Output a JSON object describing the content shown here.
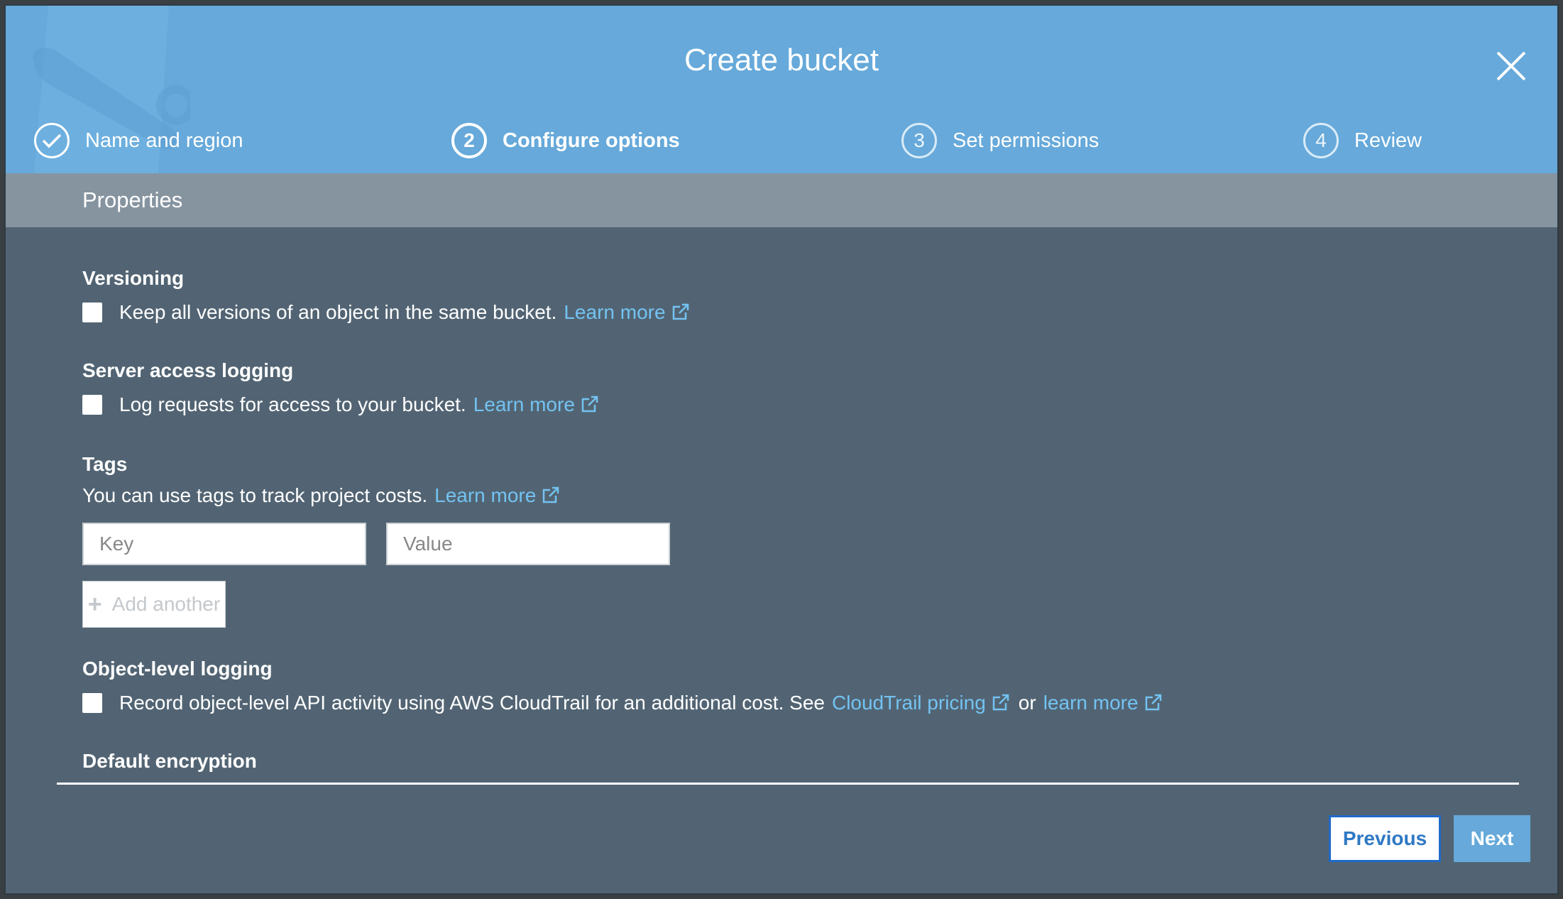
{
  "modal": {
    "title": "Create bucket",
    "steps": [
      {
        "number": "",
        "label": "Name and region",
        "state": "completed"
      },
      {
        "number": "2",
        "label": "Configure options",
        "state": "active"
      },
      {
        "number": "3",
        "label": "Set permissions",
        "state": "pending"
      },
      {
        "number": "4",
        "label": "Review",
        "state": "pending"
      }
    ],
    "section_header": "Properties"
  },
  "versioning": {
    "title": "Versioning",
    "text": "Keep all versions of an object in the same bucket.",
    "link": "Learn more",
    "checked": false
  },
  "server_logging": {
    "title": "Server access logging",
    "text": "Log requests for access to your bucket.",
    "link": "Learn more",
    "checked": false
  },
  "tags": {
    "title": "Tags",
    "text": "You can use tags to track project costs.",
    "link": "Learn more",
    "key_placeholder": "Key",
    "value_placeholder": "Value",
    "add_label": "Add another"
  },
  "object_logging": {
    "title": "Object-level logging",
    "text": "Record object-level API activity using AWS CloudTrail for an additional cost. See",
    "link1": "CloudTrail pricing",
    "or_text": "or",
    "link2": "learn more",
    "checked": false
  },
  "default_encryption": {
    "title": "Default encryption"
  },
  "footer": {
    "previous_label": "Previous",
    "next_label": "Next"
  },
  "colors": {
    "header_bg": "#66a9da",
    "body_bg": "#526473",
    "properties_bar": "#8694a0",
    "link": "#73c3f2",
    "primary_button": "#66a9da"
  }
}
